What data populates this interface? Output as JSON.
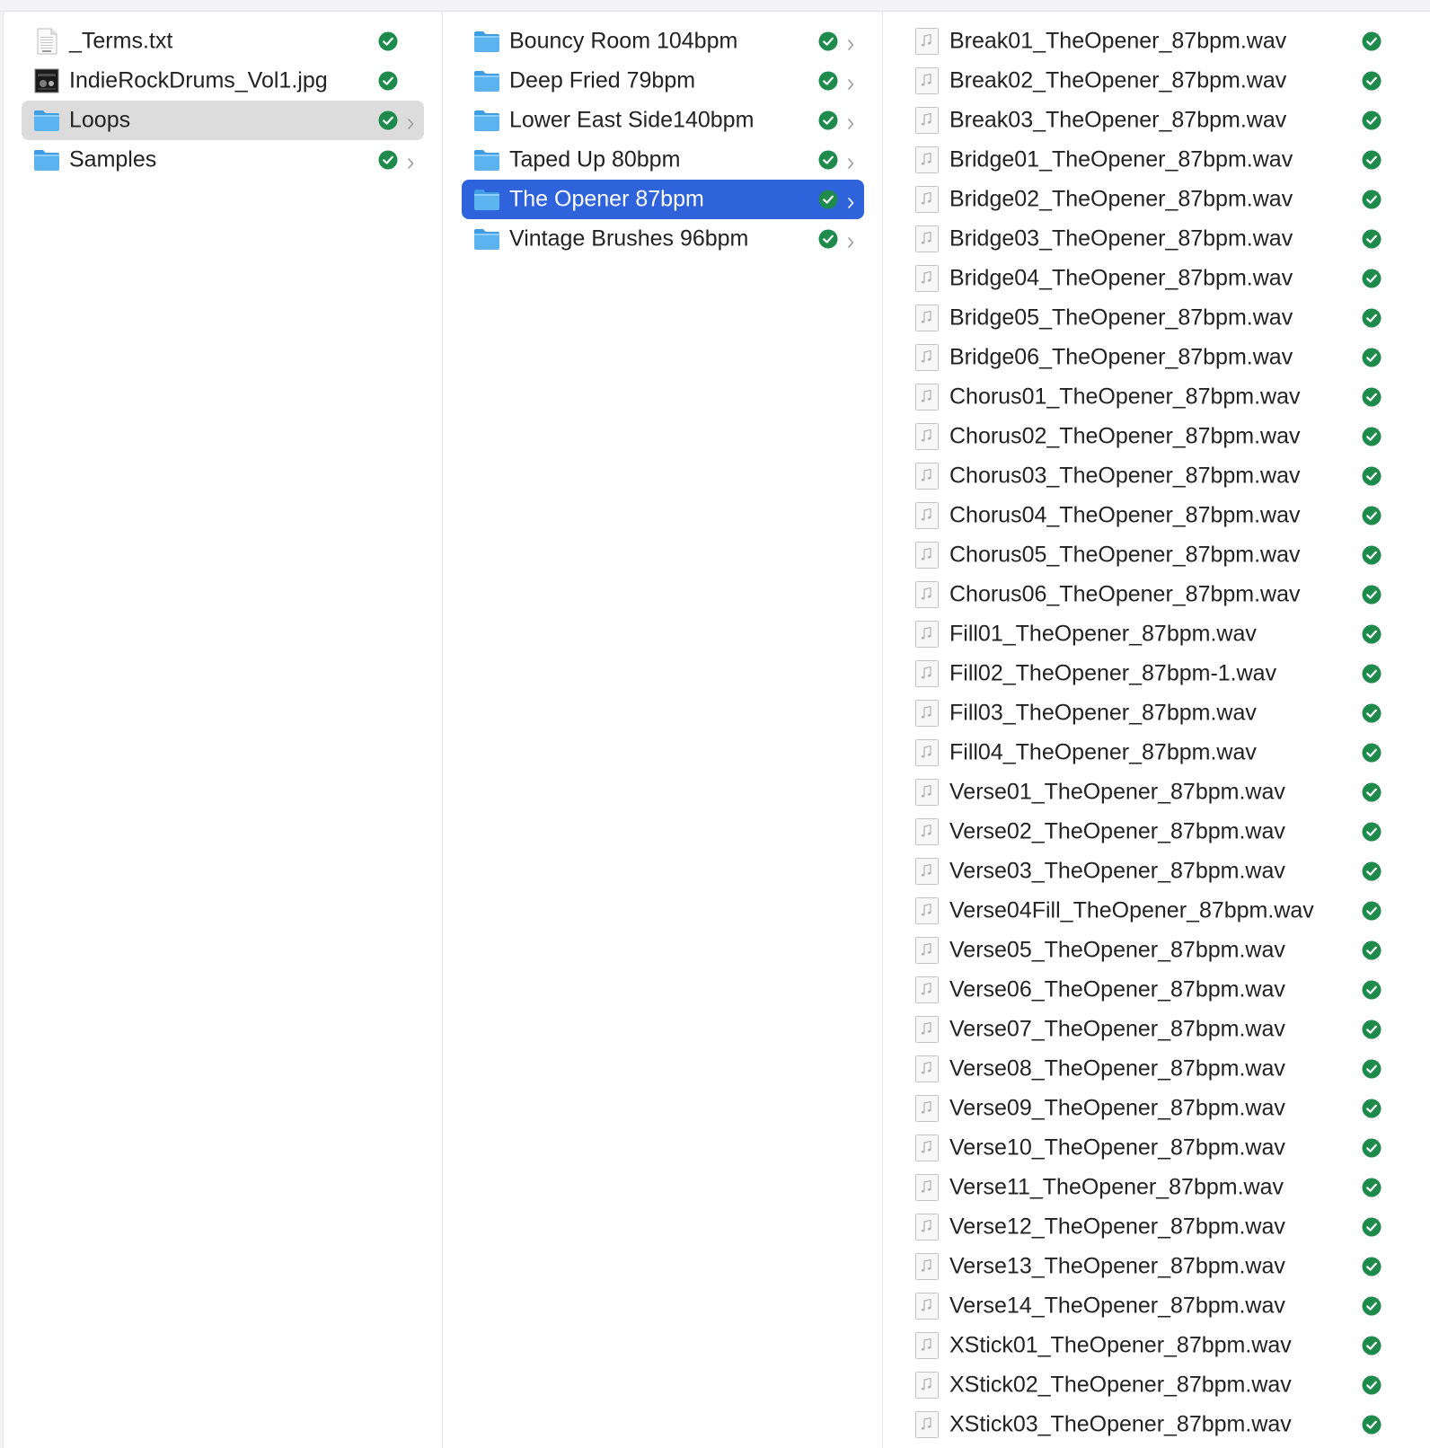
{
  "colors": {
    "selection_active": "#2f63db",
    "selection_inactive": "#dcdcdc",
    "sync_badge": "#1e8a4c",
    "folder": "#5bb4f0"
  },
  "columns": [
    {
      "items": [
        {
          "name": "_Terms.txt",
          "icon": "text-file-icon",
          "selected": "none",
          "has_children": false
        },
        {
          "name": "IndieRockDrums_Vol1.jpg",
          "icon": "image-thumbnail-icon",
          "selected": "none",
          "has_children": false
        },
        {
          "name": "Loops",
          "icon": "folder-icon",
          "selected": "inactive",
          "has_children": true
        },
        {
          "name": "Samples",
          "icon": "folder-icon",
          "selected": "none",
          "has_children": true
        }
      ]
    },
    {
      "items": [
        {
          "name": "Bouncy Room 104bpm",
          "icon": "folder-icon",
          "selected": "none",
          "has_children": true
        },
        {
          "name": "Deep Fried 79bpm",
          "icon": "folder-icon",
          "selected": "none",
          "has_children": true
        },
        {
          "name": "Lower East Side140bpm",
          "icon": "folder-icon",
          "selected": "none",
          "has_children": true
        },
        {
          "name": "Taped Up 80bpm",
          "icon": "folder-icon",
          "selected": "none",
          "has_children": true
        },
        {
          "name": "The Opener 87bpm",
          "icon": "folder-icon",
          "selected": "active",
          "has_children": true
        },
        {
          "name": "Vintage Brushes 96bpm",
          "icon": "folder-icon",
          "selected": "none",
          "has_children": true
        }
      ]
    },
    {
      "items": [
        {
          "name": "Break01_TheOpener_87bpm.wav",
          "icon": "audio-file-icon"
        },
        {
          "name": "Break02_TheOpener_87bpm.wav",
          "icon": "audio-file-icon"
        },
        {
          "name": "Break03_TheOpener_87bpm.wav",
          "icon": "audio-file-icon"
        },
        {
          "name": "Bridge01_TheOpener_87bpm.wav",
          "icon": "audio-file-icon"
        },
        {
          "name": "Bridge02_TheOpener_87bpm.wav",
          "icon": "audio-file-icon"
        },
        {
          "name": "Bridge03_TheOpener_87bpm.wav",
          "icon": "audio-file-icon"
        },
        {
          "name": "Bridge04_TheOpener_87bpm.wav",
          "icon": "audio-file-icon"
        },
        {
          "name": "Bridge05_TheOpener_87bpm.wav",
          "icon": "audio-file-icon"
        },
        {
          "name": "Bridge06_TheOpener_87bpm.wav",
          "icon": "audio-file-icon"
        },
        {
          "name": "Chorus01_TheOpener_87bpm.wav",
          "icon": "audio-file-icon"
        },
        {
          "name": "Chorus02_TheOpener_87bpm.wav",
          "icon": "audio-file-icon"
        },
        {
          "name": "Chorus03_TheOpener_87bpm.wav",
          "icon": "audio-file-icon"
        },
        {
          "name": "Chorus04_TheOpener_87bpm.wav",
          "icon": "audio-file-icon"
        },
        {
          "name": "Chorus05_TheOpener_87bpm.wav",
          "icon": "audio-file-icon"
        },
        {
          "name": "Chorus06_TheOpener_87bpm.wav",
          "icon": "audio-file-icon"
        },
        {
          "name": "Fill01_TheOpener_87bpm.wav",
          "icon": "audio-file-icon"
        },
        {
          "name": "Fill02_TheOpener_87bpm-1.wav",
          "icon": "audio-file-icon"
        },
        {
          "name": "Fill03_TheOpener_87bpm.wav",
          "icon": "audio-file-icon"
        },
        {
          "name": "Fill04_TheOpener_87bpm.wav",
          "icon": "audio-file-icon"
        },
        {
          "name": "Verse01_TheOpener_87bpm.wav",
          "icon": "audio-file-icon"
        },
        {
          "name": "Verse02_TheOpener_87bpm.wav",
          "icon": "audio-file-icon"
        },
        {
          "name": "Verse03_TheOpener_87bpm.wav",
          "icon": "audio-file-icon"
        },
        {
          "name": "Verse04Fill_TheOpener_87bpm.wav",
          "icon": "audio-file-icon"
        },
        {
          "name": "Verse05_TheOpener_87bpm.wav",
          "icon": "audio-file-icon"
        },
        {
          "name": "Verse06_TheOpener_87bpm.wav",
          "icon": "audio-file-icon"
        },
        {
          "name": "Verse07_TheOpener_87bpm.wav",
          "icon": "audio-file-icon"
        },
        {
          "name": "Verse08_TheOpener_87bpm.wav",
          "icon": "audio-file-icon"
        },
        {
          "name": "Verse09_TheOpener_87bpm.wav",
          "icon": "audio-file-icon"
        },
        {
          "name": "Verse10_TheOpener_87bpm.wav",
          "icon": "audio-file-icon"
        },
        {
          "name": "Verse11_TheOpener_87bpm.wav",
          "icon": "audio-file-icon"
        },
        {
          "name": "Verse12_TheOpener_87bpm.wav",
          "icon": "audio-file-icon"
        },
        {
          "name": "Verse13_TheOpener_87bpm.wav",
          "icon": "audio-file-icon"
        },
        {
          "name": "Verse14_TheOpener_87bpm.wav",
          "icon": "audio-file-icon"
        },
        {
          "name": "XStick01_TheOpener_87bpm.wav",
          "icon": "audio-file-icon"
        },
        {
          "name": "XStick02_TheOpener_87bpm.wav",
          "icon": "audio-file-icon"
        },
        {
          "name": "XStick03_TheOpener_87bpm.wav",
          "icon": "audio-file-icon"
        }
      ]
    }
  ]
}
